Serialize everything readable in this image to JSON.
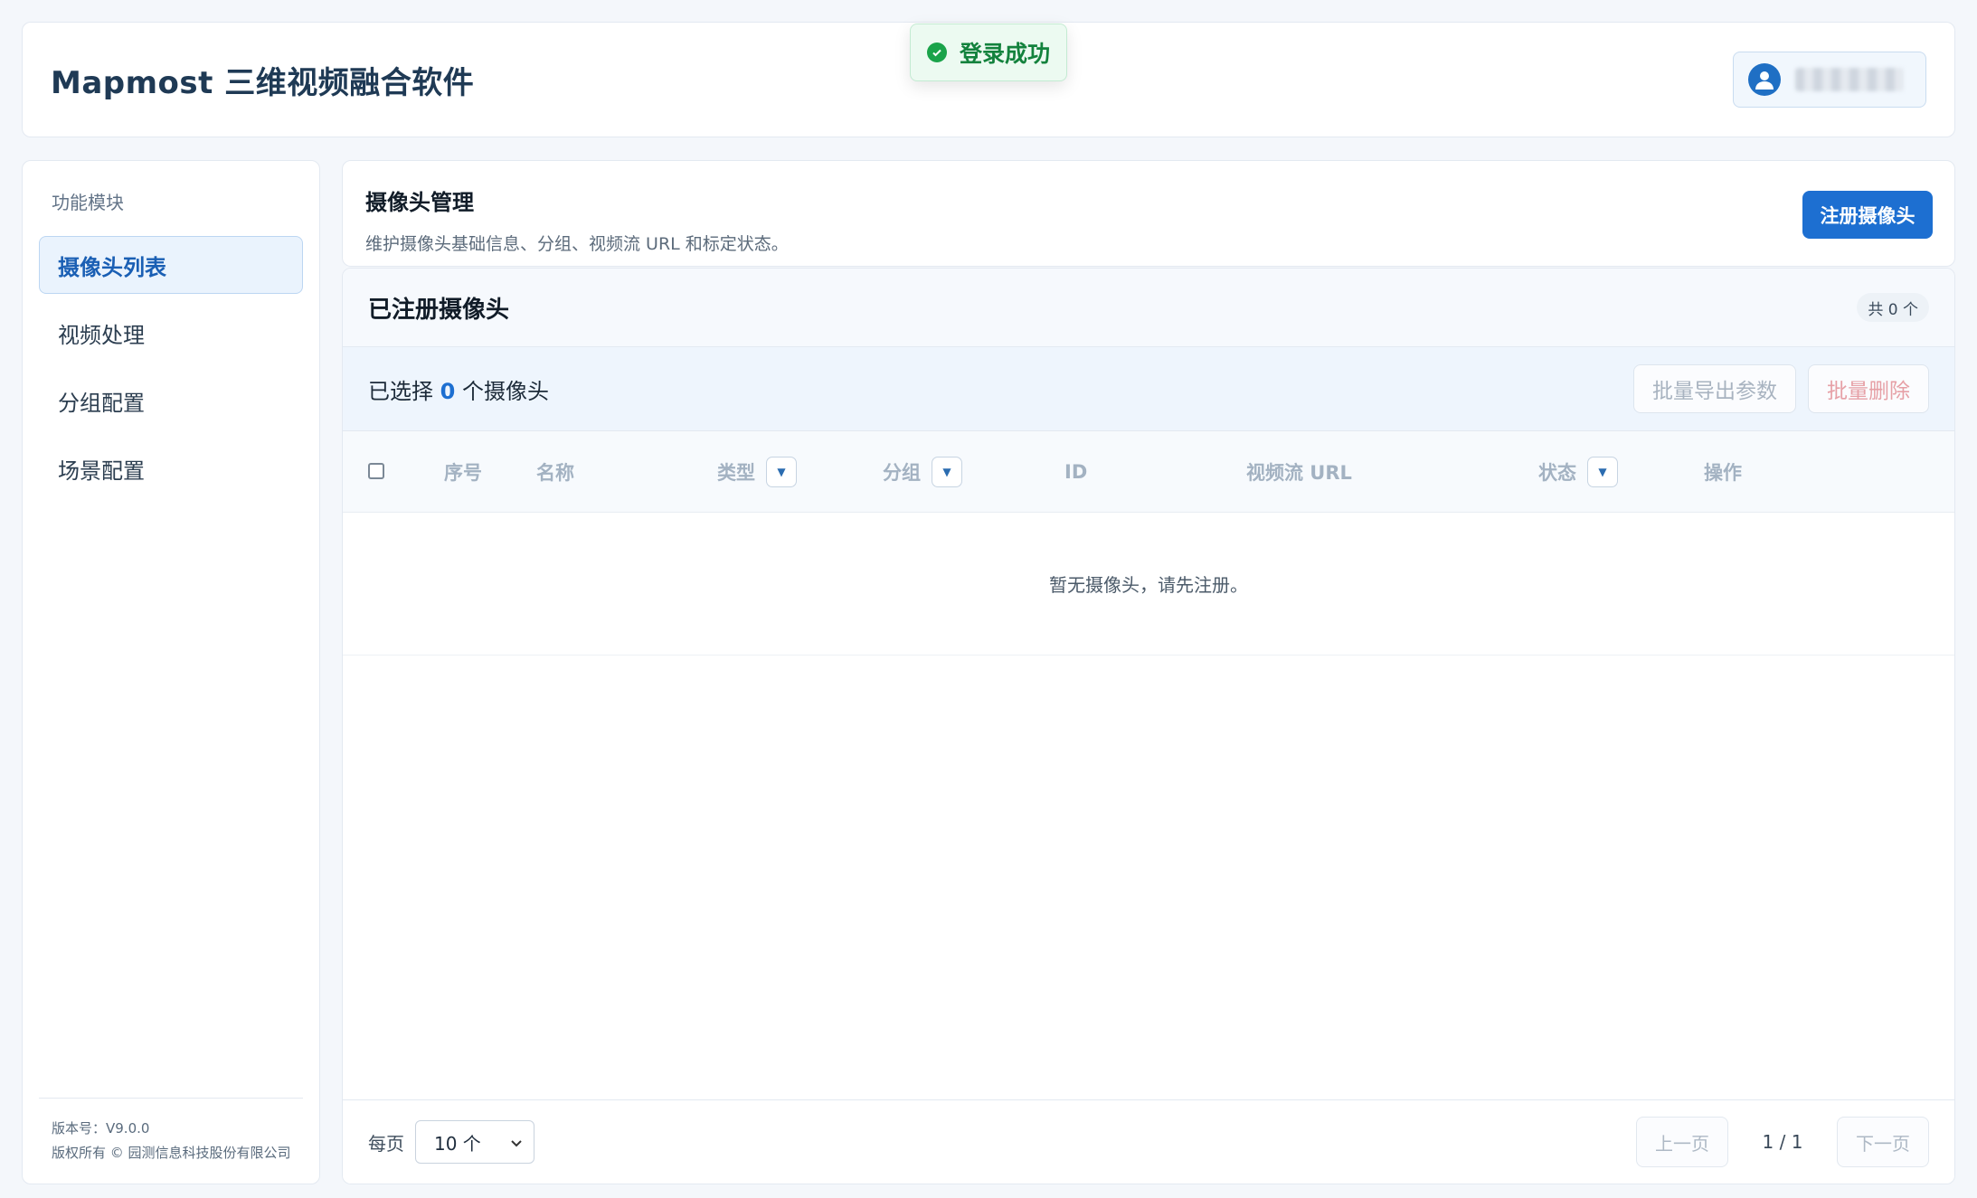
{
  "header": {
    "app_title": "Mapmost 三维视频融合软件"
  },
  "toast": {
    "message": "登录成功"
  },
  "sidebar": {
    "heading": "功能模块",
    "items": [
      {
        "label": "摄像头列表",
        "active": true
      },
      {
        "label": "视频处理"
      },
      {
        "label": "分组配置"
      },
      {
        "label": "场景配置"
      }
    ],
    "version": "版本号：V9.0.0",
    "copyright": "版权所有 © 园测信息科技股份有限公司"
  },
  "page": {
    "title": "摄像头管理",
    "description": "维护摄像头基础信息、分组、视频流 URL 和标定状态。",
    "register_button": "注册摄像头"
  },
  "panel": {
    "title": "已注册摄像头",
    "count_badge": "共 0 个",
    "selection": {
      "prefix": "已选择",
      "count": "0",
      "suffix": "个摄像头"
    },
    "batch_export": "批量导出参数",
    "batch_delete": "批量删除",
    "columns": {
      "index": "序号",
      "name": "名称",
      "type": "类型",
      "group": "分组",
      "id": "ID",
      "url": "视频流 URL",
      "status": "状态",
      "actions": "操作"
    },
    "empty_text": "暂无摄像头，请先注册。"
  },
  "footer": {
    "per_page_label": "每页",
    "per_page_value": "10 个",
    "prev": "上一页",
    "page_indicator": "1 / 1",
    "next": "下一页"
  },
  "colors": {
    "primary": "#1d6fd1",
    "success": "#1aa34a",
    "danger_text": "#e6a0a6"
  }
}
